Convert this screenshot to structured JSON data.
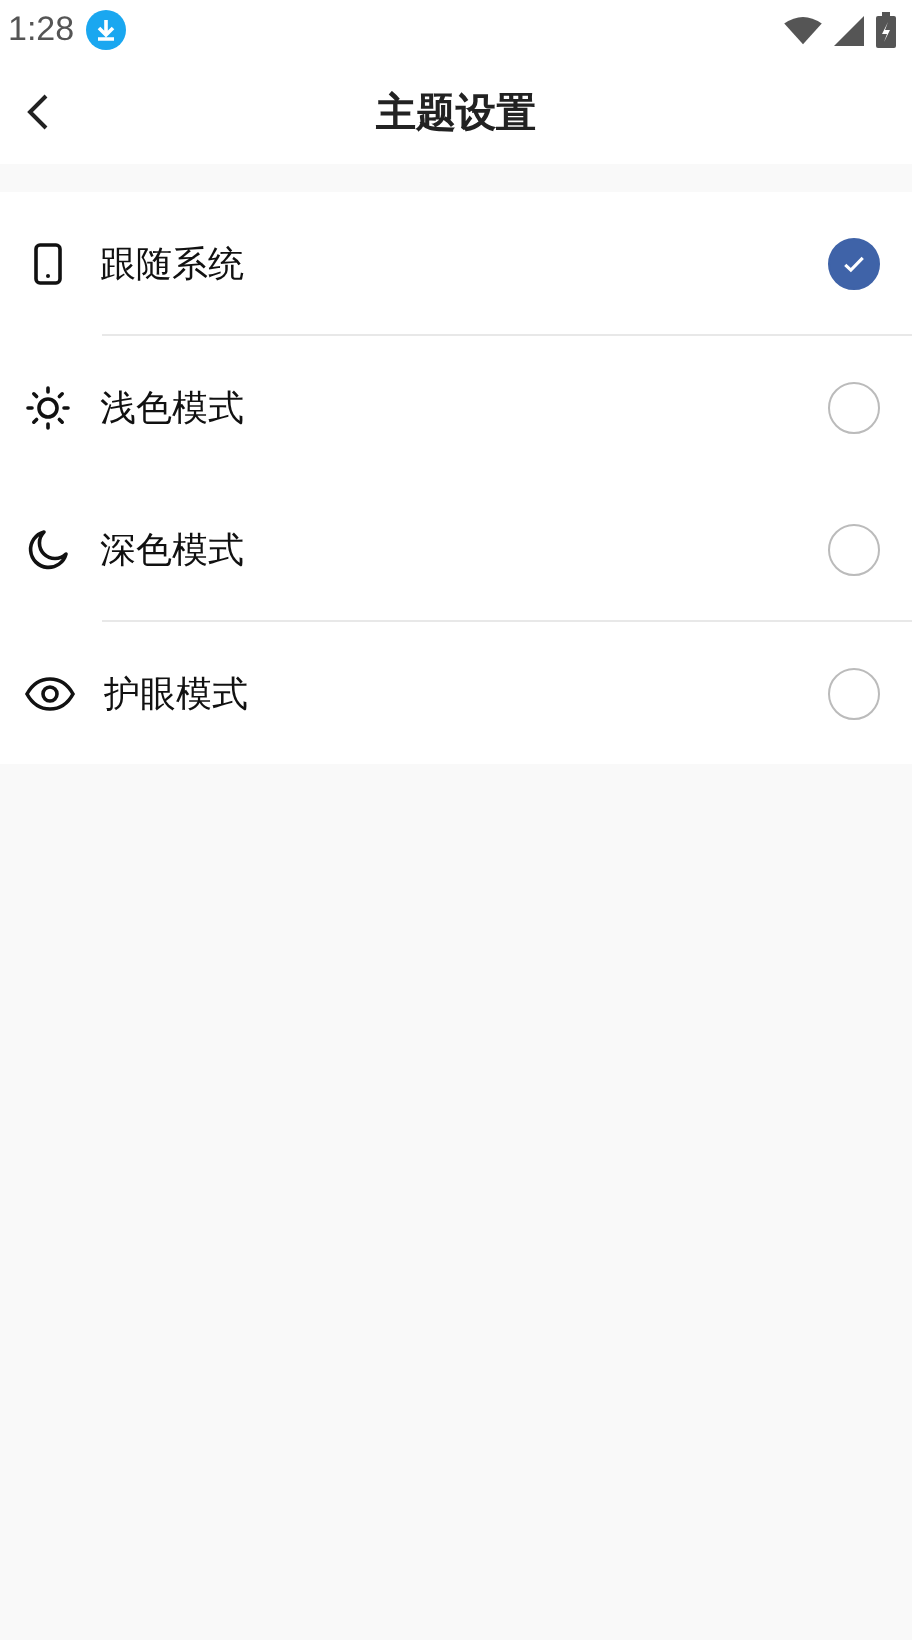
{
  "status_bar": {
    "time": "1:28"
  },
  "header": {
    "title": "主题设置"
  },
  "option_groups": [
    {
      "options": [
        {
          "label": "跟随系统",
          "selected": true
        }
      ]
    },
    {
      "options": [
        {
          "label": "浅色模式",
          "selected": false
        },
        {
          "label": "深色模式",
          "selected": false
        }
      ]
    },
    {
      "options": [
        {
          "label": "护眼模式",
          "selected": false
        }
      ]
    }
  ]
}
